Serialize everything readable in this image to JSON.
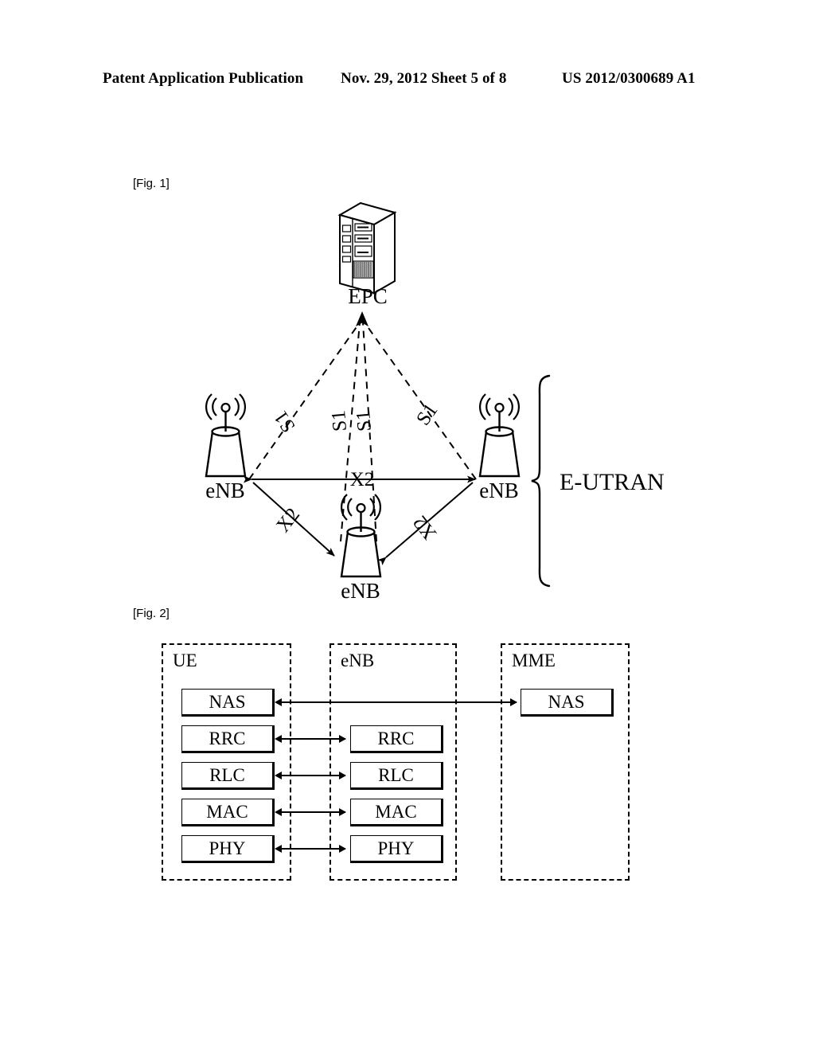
{
  "header": {
    "left": "Patent Application Publication",
    "middle": "Nov. 29, 2012  Sheet 5 of 8",
    "right": "US 2012/0300689 A1"
  },
  "figures": {
    "fig1": {
      "label": "[Fig. 1]",
      "core_node": {
        "name": "EPC",
        "icon": "server-rack-icon"
      },
      "base_stations": [
        {
          "id": "enb-left",
          "name": "eNB",
          "icon": "base-station-icon"
        },
        {
          "id": "enb-right",
          "name": "eNB",
          "icon": "base-station-icon"
        },
        {
          "id": "enb-bottom",
          "name": "eNB",
          "icon": "base-station-icon"
        }
      ],
      "s1_links": [
        {
          "label": "S1",
          "from": "enb-left",
          "to": "EPC"
        },
        {
          "label": "S1",
          "from": "enb-bottom",
          "to": "EPC"
        },
        {
          "label": "S1",
          "from": "enb-bottom",
          "to": "EPC"
        },
        {
          "label": "S1",
          "from": "enb-right",
          "to": "EPC"
        }
      ],
      "x2_links": [
        {
          "label": "X2",
          "from": "enb-left",
          "to": "enb-right"
        },
        {
          "label": "X2",
          "from": "enb-left",
          "to": "enb-bottom"
        },
        {
          "label": "X2",
          "from": "enb-bottom",
          "to": "enb-right"
        }
      ],
      "group_brace_label": "E-UTRAN"
    },
    "fig2": {
      "label": "[Fig. 2]",
      "columns": [
        {
          "id": "ue",
          "title": "UE",
          "layers": [
            "NAS",
            "RRC",
            "RLC",
            "MAC",
            "PHY"
          ]
        },
        {
          "id": "enb",
          "title": "eNB",
          "layers": [
            "RRC",
            "RLC",
            "MAC",
            "PHY"
          ]
        },
        {
          "id": "mme",
          "title": "MME",
          "layers": [
            "NAS"
          ]
        }
      ],
      "connections": [
        {
          "layer": "NAS",
          "from": "ue",
          "to": "mme",
          "bidirectional": true
        },
        {
          "layer": "RRC",
          "from": "ue",
          "to": "enb",
          "bidirectional": true
        },
        {
          "layer": "RLC",
          "from": "ue",
          "to": "enb",
          "bidirectional": true
        },
        {
          "layer": "MAC",
          "from": "ue",
          "to": "enb",
          "bidirectional": true
        },
        {
          "layer": "PHY",
          "from": "ue",
          "to": "enb",
          "bidirectional": true
        }
      ]
    }
  },
  "colors": {
    "ink": "#000000",
    "paper": "#ffffff"
  }
}
